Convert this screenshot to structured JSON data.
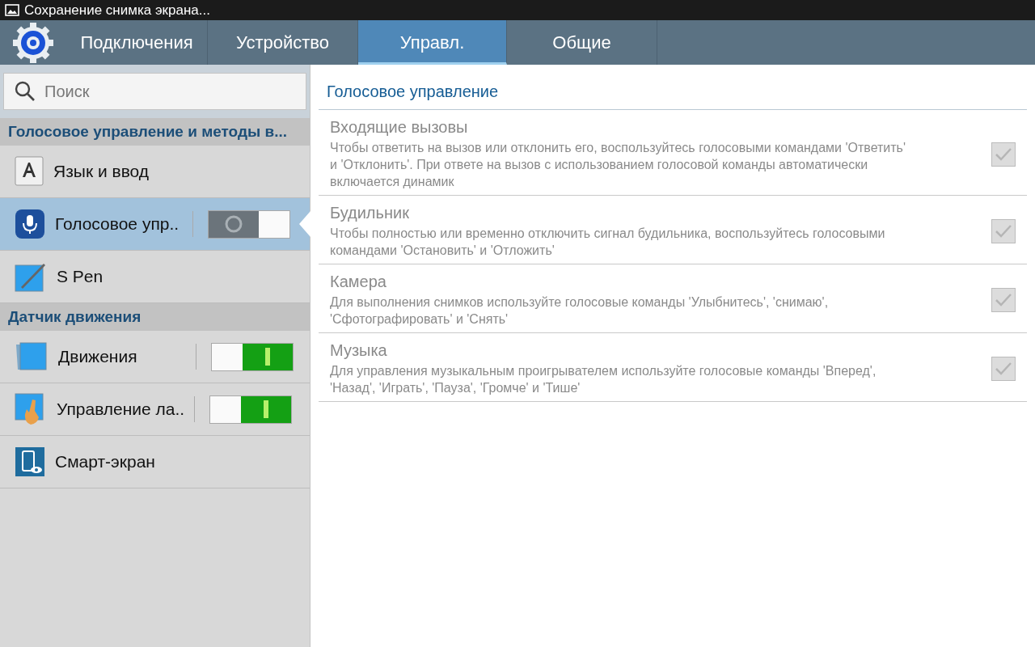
{
  "status_bar": {
    "notification": "Сохранение снимка экрана..."
  },
  "tabs": [
    {
      "label": "Подключения",
      "selected": false
    },
    {
      "label": "Устройство",
      "selected": false
    },
    {
      "label": "Управл.",
      "selected": true
    },
    {
      "label": "Общие",
      "selected": false
    }
  ],
  "search": {
    "placeholder": "Поиск"
  },
  "sidebar": {
    "sections": [
      {
        "title": "Голосовое управление и методы в...",
        "items": [
          {
            "label": "Язык и ввод",
            "selected": false
          },
          {
            "label": "Голосовое упр..",
            "selected": true,
            "toggle": {
              "on": false
            }
          },
          {
            "label": "S Pen",
            "selected": false
          }
        ]
      },
      {
        "title": "Датчик движения",
        "items": [
          {
            "label": "Движения",
            "selected": false,
            "toggle": {
              "on": true
            }
          },
          {
            "label": "Управление ла..",
            "selected": false,
            "toggle": {
              "on": true
            }
          },
          {
            "label": "Смарт-экран",
            "selected": false
          }
        ]
      }
    ]
  },
  "content": {
    "title": "Голосовое управление",
    "settings": [
      {
        "title": "Входящие вызовы",
        "description": "Чтобы ответить на вызов или отклонить его, воспользуйтесь голосовыми командами 'Ответить' и 'Отклонить'. При ответе на вызов с использованием голосовой команды автоматически включается динамик",
        "checked": true,
        "disabled": true
      },
      {
        "title": "Будильник",
        "description": "Чтобы полностью или временно отключить сигнал будильника, воспользуйтесь голосовыми командами 'Остановить' и 'Отложить'",
        "checked": true,
        "disabled": true
      },
      {
        "title": "Камера",
        "description": "Для выполнения снимков используйте голосовые команды 'Улыбнитесь', 'снимаю', 'Сфотографировать' и 'Снять'",
        "checked": true,
        "disabled": true
      },
      {
        "title": "Музыка",
        "description": "Для управления музыкальным проигрывателем используйте голосовые команды 'Вперед', 'Назад', 'Играть', 'Пауза', 'Громче' и 'Тише'",
        "checked": true,
        "disabled": true
      }
    ]
  }
}
